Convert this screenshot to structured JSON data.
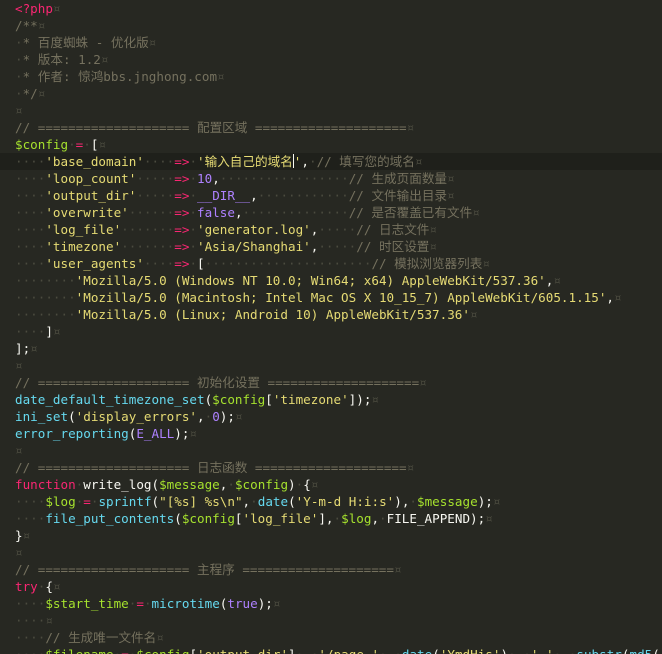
{
  "colors": {
    "background": "#272822",
    "default": "#f8f8f2",
    "comment": "#75715e",
    "keyword": "#f92672",
    "string": "#e6db74",
    "number": "#ae81ff",
    "function": "#66d9ef",
    "variable": "#a6e22e",
    "invisible": "#4b4b3f",
    "active_line": "#1f201b"
  },
  "editor": {
    "active_line_index": 9,
    "lines": [
      [
        [
          "k",
          "<?php"
        ],
        [
          "w",
          "¤"
        ]
      ],
      [
        [
          "c",
          "/**"
        ],
        [
          "w",
          "¤"
        ]
      ],
      [
        [
          "w",
          "·"
        ],
        [
          "c",
          "* 百度蜘蛛 - 优化版"
        ],
        [
          "w",
          "¤"
        ]
      ],
      [
        [
          "w",
          "·"
        ],
        [
          "c",
          "* 版本: 1.2"
        ],
        [
          "w",
          "¤"
        ]
      ],
      [
        [
          "w",
          "·"
        ],
        [
          "c",
          "* 作者: 惊鸿bbs.jnghong.com"
        ],
        [
          "w",
          "¤"
        ]
      ],
      [
        [
          "w",
          "·"
        ],
        [
          "c",
          "*/"
        ],
        [
          "w",
          "¤"
        ]
      ],
      [
        [
          "w",
          "¤"
        ]
      ],
      [
        [
          "c",
          "// ==================== 配置区域 ===================="
        ],
        [
          "w",
          "¤"
        ]
      ],
      [
        [
          "v",
          "$config"
        ],
        [
          "w",
          "·"
        ],
        [
          "k",
          "="
        ],
        [
          "w",
          "·"
        ],
        [
          "d",
          "["
        ],
        [
          "w",
          "¤"
        ]
      ],
      [
        [
          "w",
          "····"
        ],
        [
          "s",
          "'base_domain'"
        ],
        [
          "w",
          "····"
        ],
        [
          "k",
          "=>"
        ],
        [
          "w",
          "·"
        ],
        [
          "s",
          "'输入自己的域名"
        ],
        [
          "cur",
          ""
        ],
        [
          "s",
          "'"
        ],
        [
          "d",
          ","
        ],
        [
          "w",
          "·"
        ],
        [
          "c",
          "// 填写您的域名"
        ],
        [
          "w",
          "¤"
        ]
      ],
      [
        [
          "w",
          "····"
        ],
        [
          "s",
          "'loop_count'"
        ],
        [
          "w",
          "·····"
        ],
        [
          "k",
          "=>"
        ],
        [
          "w",
          "·"
        ],
        [
          "n",
          "10"
        ],
        [
          "d",
          ","
        ],
        [
          "w",
          "·················"
        ],
        [
          "c",
          "// 生成页面数量"
        ],
        [
          "w",
          "¤"
        ]
      ],
      [
        [
          "w",
          "····"
        ],
        [
          "s",
          "'output_dir'"
        ],
        [
          "w",
          "·····"
        ],
        [
          "k",
          "=>"
        ],
        [
          "w",
          "·"
        ],
        [
          "n",
          "__DIR__"
        ],
        [
          "d",
          ","
        ],
        [
          "w",
          "············"
        ],
        [
          "c",
          "// 文件输出目录"
        ],
        [
          "w",
          "¤"
        ]
      ],
      [
        [
          "w",
          "····"
        ],
        [
          "s",
          "'overwrite'"
        ],
        [
          "w",
          "······"
        ],
        [
          "k",
          "=>"
        ],
        [
          "w",
          "·"
        ],
        [
          "n",
          "false"
        ],
        [
          "d",
          ","
        ],
        [
          "w",
          "··············"
        ],
        [
          "c",
          "// 是否覆盖已有文件"
        ],
        [
          "w",
          "¤"
        ]
      ],
      [
        [
          "w",
          "····"
        ],
        [
          "s",
          "'log_file'"
        ],
        [
          "w",
          "·······"
        ],
        [
          "k",
          "=>"
        ],
        [
          "w",
          "·"
        ],
        [
          "s",
          "'generator.log'"
        ],
        [
          "d",
          ","
        ],
        [
          "w",
          "·····"
        ],
        [
          "c",
          "// 日志文件"
        ],
        [
          "w",
          "¤"
        ]
      ],
      [
        [
          "w",
          "····"
        ],
        [
          "s",
          "'timezone'"
        ],
        [
          "w",
          "·······"
        ],
        [
          "k",
          "=>"
        ],
        [
          "w",
          "·"
        ],
        [
          "s",
          "'Asia/Shanghai'"
        ],
        [
          "d",
          ","
        ],
        [
          "w",
          "·····"
        ],
        [
          "c",
          "// 时区设置"
        ],
        [
          "w",
          "¤"
        ]
      ],
      [
        [
          "w",
          "····"
        ],
        [
          "s",
          "'user_agents'"
        ],
        [
          "w",
          "····"
        ],
        [
          "k",
          "=>"
        ],
        [
          "w",
          "·"
        ],
        [
          "d",
          "["
        ],
        [
          "w",
          "······················"
        ],
        [
          "c",
          "// 模拟浏览器列表"
        ],
        [
          "w",
          "¤"
        ]
      ],
      [
        [
          "w",
          "········"
        ],
        [
          "s",
          "'Mozilla/5.0 (Windows NT 10.0; Win64; x64) AppleWebKit/537.36'"
        ],
        [
          "d",
          ","
        ],
        [
          "w",
          "¤"
        ]
      ],
      [
        [
          "w",
          "········"
        ],
        [
          "s",
          "'Mozilla/5.0 (Macintosh; Intel Mac OS X 10_15_7) AppleWebKit/605.1.15'"
        ],
        [
          "d",
          ","
        ],
        [
          "w",
          "¤"
        ]
      ],
      [
        [
          "w",
          "········"
        ],
        [
          "s",
          "'Mozilla/5.0 (Linux; Android 10) AppleWebKit/537.36'"
        ],
        [
          "w",
          "¤"
        ]
      ],
      [
        [
          "w",
          "····"
        ],
        [
          "d",
          "]"
        ],
        [
          "w",
          "¤"
        ]
      ],
      [
        [
          "d",
          "];"
        ],
        [
          "w",
          "¤"
        ]
      ],
      [
        [
          "w",
          "¤"
        ]
      ],
      [
        [
          "c",
          "// ==================== 初始化设置 ===================="
        ],
        [
          "w",
          "¤"
        ]
      ],
      [
        [
          "f",
          "date_default_timezone_set"
        ],
        [
          "d",
          "("
        ],
        [
          "v",
          "$config"
        ],
        [
          "d",
          "["
        ],
        [
          "s",
          "'timezone'"
        ],
        [
          "d",
          "]);"
        ],
        [
          "w",
          "¤"
        ]
      ],
      [
        [
          "f",
          "ini_set"
        ],
        [
          "d",
          "("
        ],
        [
          "s",
          "'display_errors'"
        ],
        [
          "d",
          ","
        ],
        [
          "w",
          "·"
        ],
        [
          "n",
          "0"
        ],
        [
          "d",
          ");"
        ],
        [
          "w",
          "¤"
        ]
      ],
      [
        [
          "f",
          "error_reporting"
        ],
        [
          "d",
          "("
        ],
        [
          "n",
          "E_ALL"
        ],
        [
          "d",
          ");"
        ],
        [
          "w",
          "¤"
        ]
      ],
      [
        [
          "w",
          "¤"
        ]
      ],
      [
        [
          "c",
          "// ==================== 日志函数 ===================="
        ],
        [
          "w",
          "¤"
        ]
      ],
      [
        [
          "k",
          "function"
        ],
        [
          "w",
          "·"
        ],
        [
          "d",
          "write_log("
        ],
        [
          "v",
          "$message"
        ],
        [
          "d",
          ","
        ],
        [
          "w",
          "·"
        ],
        [
          "v",
          "$config"
        ],
        [
          "d",
          ")"
        ],
        [
          "w",
          "·"
        ],
        [
          "d",
          "{"
        ],
        [
          "w",
          "¤"
        ]
      ],
      [
        [
          "w",
          "····"
        ],
        [
          "v",
          "$log"
        ],
        [
          "w",
          "·"
        ],
        [
          "k",
          "="
        ],
        [
          "w",
          "·"
        ],
        [
          "f",
          "sprintf"
        ],
        [
          "d",
          "("
        ],
        [
          "s",
          "\"[%s] %s\\n\""
        ],
        [
          "d",
          ","
        ],
        [
          "w",
          "·"
        ],
        [
          "f",
          "date"
        ],
        [
          "d",
          "("
        ],
        [
          "s",
          "'Y-m-d H:i:s'"
        ],
        [
          "d",
          "),"
        ],
        [
          "w",
          "·"
        ],
        [
          "v",
          "$message"
        ],
        [
          "d",
          ");"
        ],
        [
          "w",
          "¤"
        ]
      ],
      [
        [
          "w",
          "····"
        ],
        [
          "f",
          "file_put_contents"
        ],
        [
          "d",
          "("
        ],
        [
          "v",
          "$config"
        ],
        [
          "d",
          "["
        ],
        [
          "s",
          "'log_file'"
        ],
        [
          "d",
          "],"
        ],
        [
          "w",
          "·"
        ],
        [
          "v",
          "$log"
        ],
        [
          "d",
          ","
        ],
        [
          "w",
          "·"
        ],
        [
          "d",
          "FILE_APPEND);"
        ],
        [
          "w",
          "¤"
        ]
      ],
      [
        [
          "d",
          "}"
        ],
        [
          "w",
          "¤"
        ]
      ],
      [
        [
          "w",
          "¤"
        ]
      ],
      [
        [
          "c",
          "// ==================== 主程序 ===================="
        ],
        [
          "w",
          "¤"
        ]
      ],
      [
        [
          "k",
          "try"
        ],
        [
          "w",
          "·"
        ],
        [
          "d",
          "{"
        ],
        [
          "w",
          "¤"
        ]
      ],
      [
        [
          "w",
          "····"
        ],
        [
          "v",
          "$start_time"
        ],
        [
          "w",
          "·"
        ],
        [
          "k",
          "="
        ],
        [
          "w",
          "·"
        ],
        [
          "f",
          "microtime"
        ],
        [
          "d",
          "("
        ],
        [
          "n",
          "true"
        ],
        [
          "d",
          ");"
        ],
        [
          "w",
          "¤"
        ]
      ],
      [
        [
          "w",
          "····¤"
        ]
      ],
      [
        [
          "w",
          "····"
        ],
        [
          "c",
          "// 生成唯一文件名"
        ],
        [
          "w",
          "¤"
        ]
      ],
      [
        [
          "w",
          "····"
        ],
        [
          "v",
          "$filename"
        ],
        [
          "w",
          "·"
        ],
        [
          "k",
          "="
        ],
        [
          "w",
          "·"
        ],
        [
          "v",
          "$config"
        ],
        [
          "d",
          "["
        ],
        [
          "s",
          "'output_dir'"
        ],
        [
          "d",
          "]"
        ],
        [
          "w",
          "·"
        ],
        [
          "k",
          "."
        ],
        [
          "w",
          "·"
        ],
        [
          "s",
          "'/page_'"
        ],
        [
          "w",
          "·"
        ],
        [
          "k",
          "."
        ],
        [
          "w",
          "·"
        ],
        [
          "f",
          "date"
        ],
        [
          "d",
          "("
        ],
        [
          "s",
          "'YmdHis'"
        ],
        [
          "d",
          ")"
        ],
        [
          "w",
          "·"
        ],
        [
          "k",
          "."
        ],
        [
          "w",
          "·"
        ],
        [
          "s",
          "'_'"
        ],
        [
          "w",
          "·"
        ],
        [
          "k",
          "."
        ],
        [
          "w",
          "·"
        ],
        [
          "f",
          "substr"
        ],
        [
          "d",
          "("
        ],
        [
          "f",
          "md5"
        ],
        [
          "d",
          "("
        ]
      ]
    ]
  }
}
